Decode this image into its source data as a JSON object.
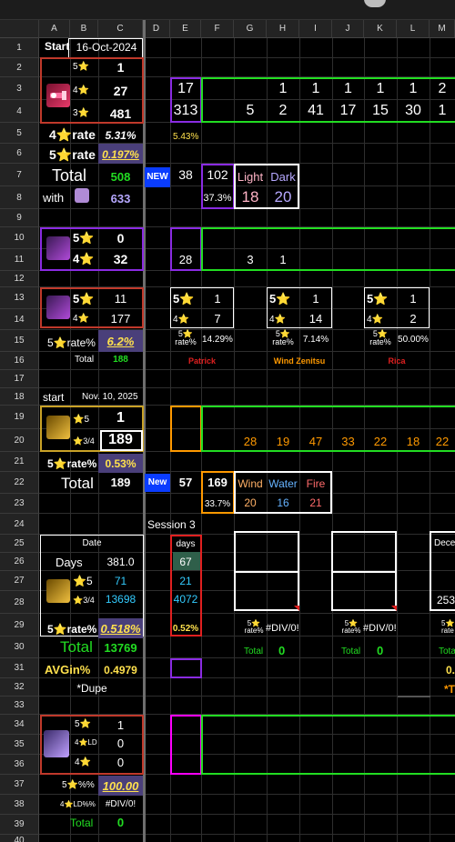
{
  "columns": [
    "A",
    "B",
    "C",
    "D",
    "E",
    "F",
    "G",
    "H",
    "I",
    "J",
    "K",
    "L",
    "M"
  ],
  "rows": [
    "1",
    "2",
    "3",
    "4",
    "5",
    "6",
    "7",
    "8",
    "9",
    "10",
    "11",
    "12",
    "13",
    "14",
    "15",
    "16",
    "17",
    "18",
    "19",
    "20",
    "21",
    "22",
    "23",
    "24",
    "25",
    "26",
    "27",
    "28",
    "29",
    "30",
    "31",
    "32",
    "33",
    "34",
    "35",
    "36",
    "37",
    "38",
    "39",
    "40"
  ],
  "colors": {
    "green": "#22dd22",
    "purple": "#8a2be2",
    "yellow": "#ffe14d",
    "orange": "#ff9900",
    "red": "#e02020",
    "magenta": "#ff00ff",
    "cyan": "#33ccff",
    "white": "#ffffff"
  },
  "icons": {
    "banner_1": "rocket-launcher-icon",
    "banner_2": "ticket-icon",
    "banner_3": "scroll-icon",
    "banner_4": "scroll-icon",
    "banner_5": "golden-key-icon",
    "banner_6": "golden-key-icon",
    "banner_7": "hourglass-icon",
    "star": "star-icon"
  },
  "sheet": {
    "a1": "Start",
    "b1": "16-Oct-2024",
    "b2": "5⭐",
    "c2": "1",
    "b3": "4⭐",
    "c3": "27",
    "b4": "3⭐",
    "c4": "481",
    "a5": "4⭐rate",
    "c5": "5.31%",
    "a6": "5⭐rate",
    "c6": "0.197%",
    "a7": "Total",
    "c7": "508",
    "a8": "with",
    "c8": "633",
    "e3": "17",
    "h3": "1",
    "i3": "1",
    "j3": "1",
    "k3": "1",
    "l3": "1",
    "m3": "2",
    "e4": "313",
    "g4": "5",
    "h4": "2",
    "i4": "41",
    "j4": "17",
    "k4": "15",
    "l4": "30",
    "m4": "1",
    "e5": "5.43%",
    "d7": "NEW",
    "e7": "38",
    "f7": "102",
    "g7": "Light",
    "h7": "Dark",
    "f8": "37.3%",
    "g8": "18",
    "h8": "20",
    "b10": "5⭐",
    "c10": "0",
    "b11": "4⭐",
    "c11": "32",
    "e11": "28",
    "g11": "3",
    "h11": "1",
    "b13": "5⭐",
    "c13": "11",
    "b14": "4⭐",
    "c14": "177",
    "a15": "5⭐rate%",
    "c15": "6.2%",
    "b16": "Total",
    "c16": "188",
    "sub1_top": "5⭐",
    "sub1_val1": "1",
    "sub1_mid": "4⭐",
    "sub1_val2": "7",
    "sub1_rate": "5⭐\nrate%",
    "sub1_pct": "14.29%",
    "sub1_name": "Patrick",
    "sub2_top": "5⭐",
    "sub2_val1": "1",
    "sub2_mid": "4⭐",
    "sub2_val2": "14",
    "sub2_rate": "5⭐\nrate%",
    "sub2_pct": "7.14%",
    "sub2_name": "Wind Zenitsu",
    "sub3_top": "5⭐",
    "sub3_val1": "1",
    "sub3_mid": "4⭐",
    "sub3_val2": "2",
    "sub3_rate": "5⭐\nrate%",
    "sub3_pct": "50.00%",
    "sub3_name": "Rica",
    "a18": "start",
    "b18": "Nov. 10, 2025",
    "b19": "⭐5",
    "c19": "1",
    "b20": "⭐3/4",
    "c20": "189",
    "g20": "28",
    "h20": "19",
    "i20": "47",
    "j20": "33",
    "k20": "22",
    "l20": "18",
    "m20": "22",
    "a21": "5⭐rate%",
    "c21": "0.53%",
    "a22": "Total",
    "c22": "189",
    "d22": "New",
    "e22": "57",
    "f22": "169",
    "g22": "Wind",
    "h22": "Water",
    "i22": "Fire",
    "f23": "33.7%",
    "g23": "20",
    "h23": "16",
    "i23": "21",
    "d24": "Session 3",
    "b25": "Date",
    "e25": "days",
    "m25": "Dece",
    "a26": "Days",
    "c26": "381.0",
    "e26": "67",
    "b27": "⭐5",
    "c27": "71",
    "e27": "21",
    "b28": "⭐3/4",
    "c28": "13698",
    "e28": "4072",
    "m28": "253",
    "a29": "5⭐rate%",
    "c29": "0.518%",
    "e29": "0.52%",
    "g29a": "5⭐\nrate%",
    "g29b": "#DIV/0!",
    "j29a": "5⭐\nrate%",
    "j29b": "#DIV/0!",
    "m29": "5⭐\nrate",
    "a30": "Total",
    "c30": "13769",
    "g30": "Total",
    "h30": "0",
    "j30": "Total",
    "k30": "0",
    "m30": "Tota",
    "a31": "AVGin%",
    "c31": "0.4979",
    "m31": "0.",
    "a32": "*Dupe",
    "m32": "*T",
    "b34": "5⭐",
    "c34": "1",
    "b35": "4⭐LD",
    "c35": "0",
    "b36": "4⭐",
    "c36": "0",
    "a37": "5⭐%%",
    "c37": "100.00",
    "a38": "4⭐LD%%",
    "c38": "#DIV/0!",
    "a39": "Total",
    "c39": "0"
  }
}
